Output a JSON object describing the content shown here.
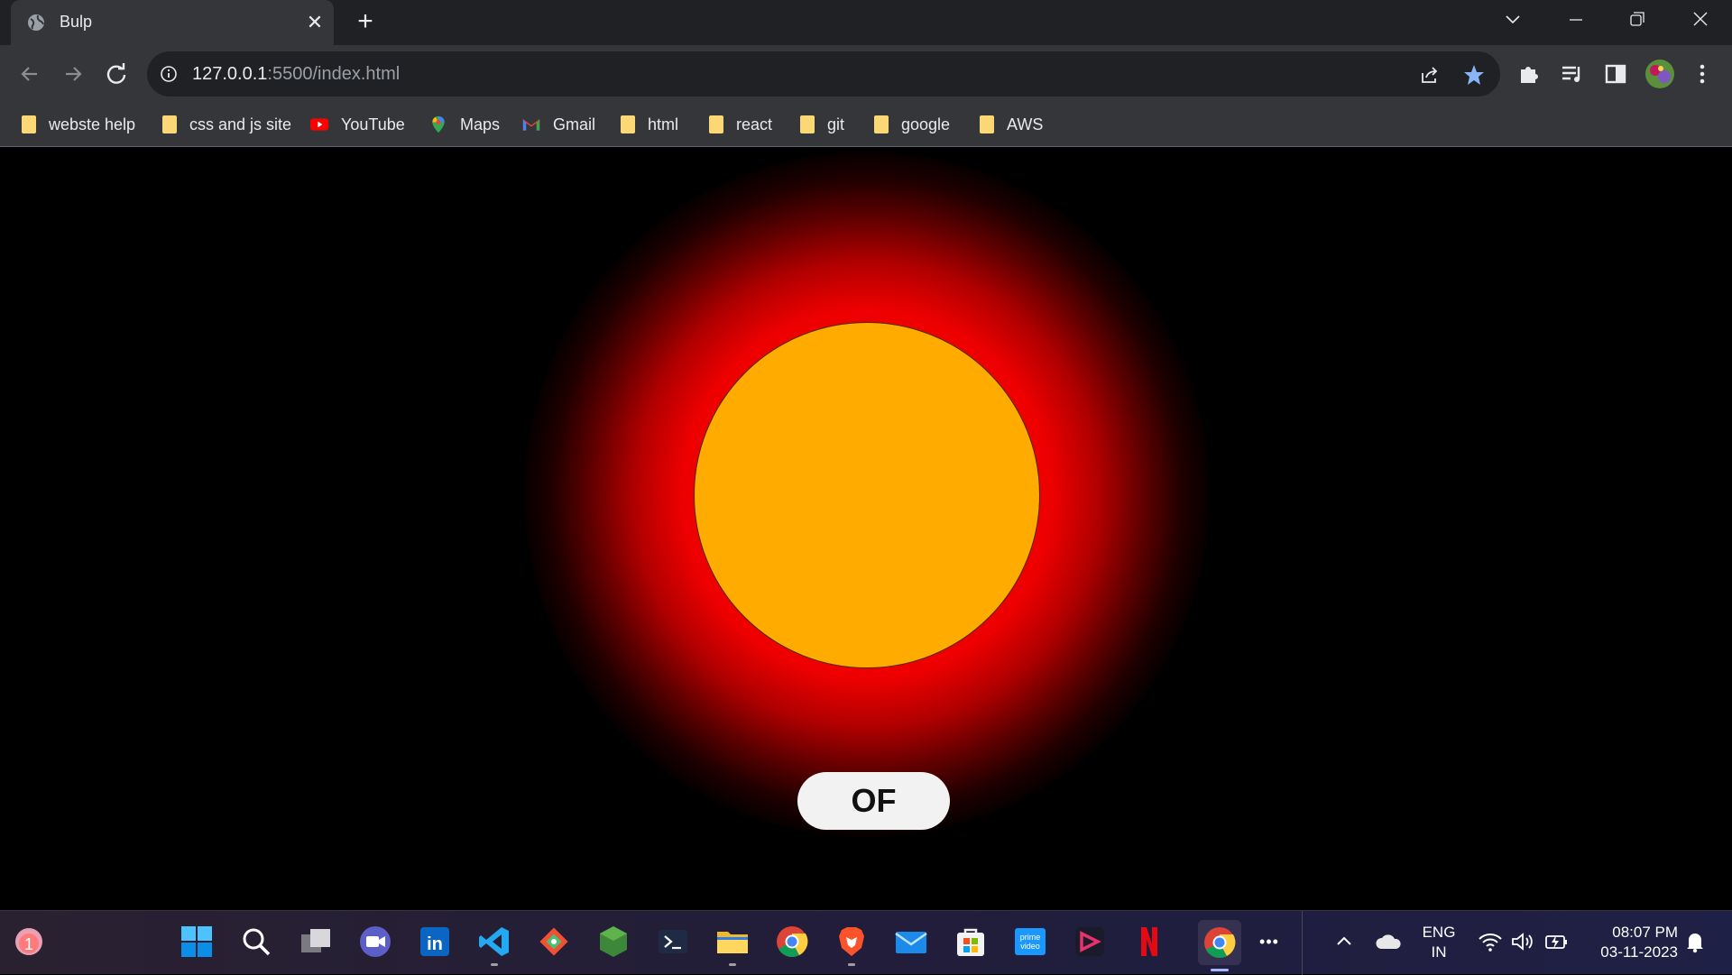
{
  "browser": {
    "tab": {
      "title": "Bulp",
      "close": "✕"
    },
    "new_tab": "+",
    "address": {
      "host": "127.0.0.1",
      "rest": ":5500/index.html"
    }
  },
  "bookmarks": [
    {
      "label": "webste help",
      "icon": "folder-icon"
    },
    {
      "label": "css and js site",
      "icon": "folder-icon"
    },
    {
      "label": "YouTube",
      "icon": "youtube-icon"
    },
    {
      "label": "Maps",
      "icon": "maps-icon"
    },
    {
      "label": "Gmail",
      "icon": "gmail-icon"
    },
    {
      "label": "html",
      "icon": "folder-icon"
    },
    {
      "label": "react",
      "icon": "folder-icon"
    },
    {
      "label": "git",
      "icon": "folder-icon"
    },
    {
      "label": "google",
      "icon": "folder-icon"
    },
    {
      "label": "AWS",
      "icon": "folder-icon"
    }
  ],
  "page": {
    "bulb_color": "#ffab00",
    "glow_color": "#ff0000",
    "toggle_label": "OF"
  },
  "taskbar": {
    "notification_badge": "1",
    "apps": [
      "start-icon",
      "search-icon",
      "task-view-icon",
      "teams-icon",
      "linkedin-icon",
      "vscode-icon",
      "git-icon",
      "node-icon",
      "terminal-icon",
      "file-explorer-icon",
      "chrome-icon",
      "brave-icon",
      "mail-icon",
      "store-icon",
      "prime-video-icon",
      "app-icon",
      "netflix-icon",
      "chrome-icon"
    ],
    "more": "•••",
    "language": "ENG",
    "region": "IN",
    "time": "08:07 PM",
    "date": "03-11-2023"
  }
}
